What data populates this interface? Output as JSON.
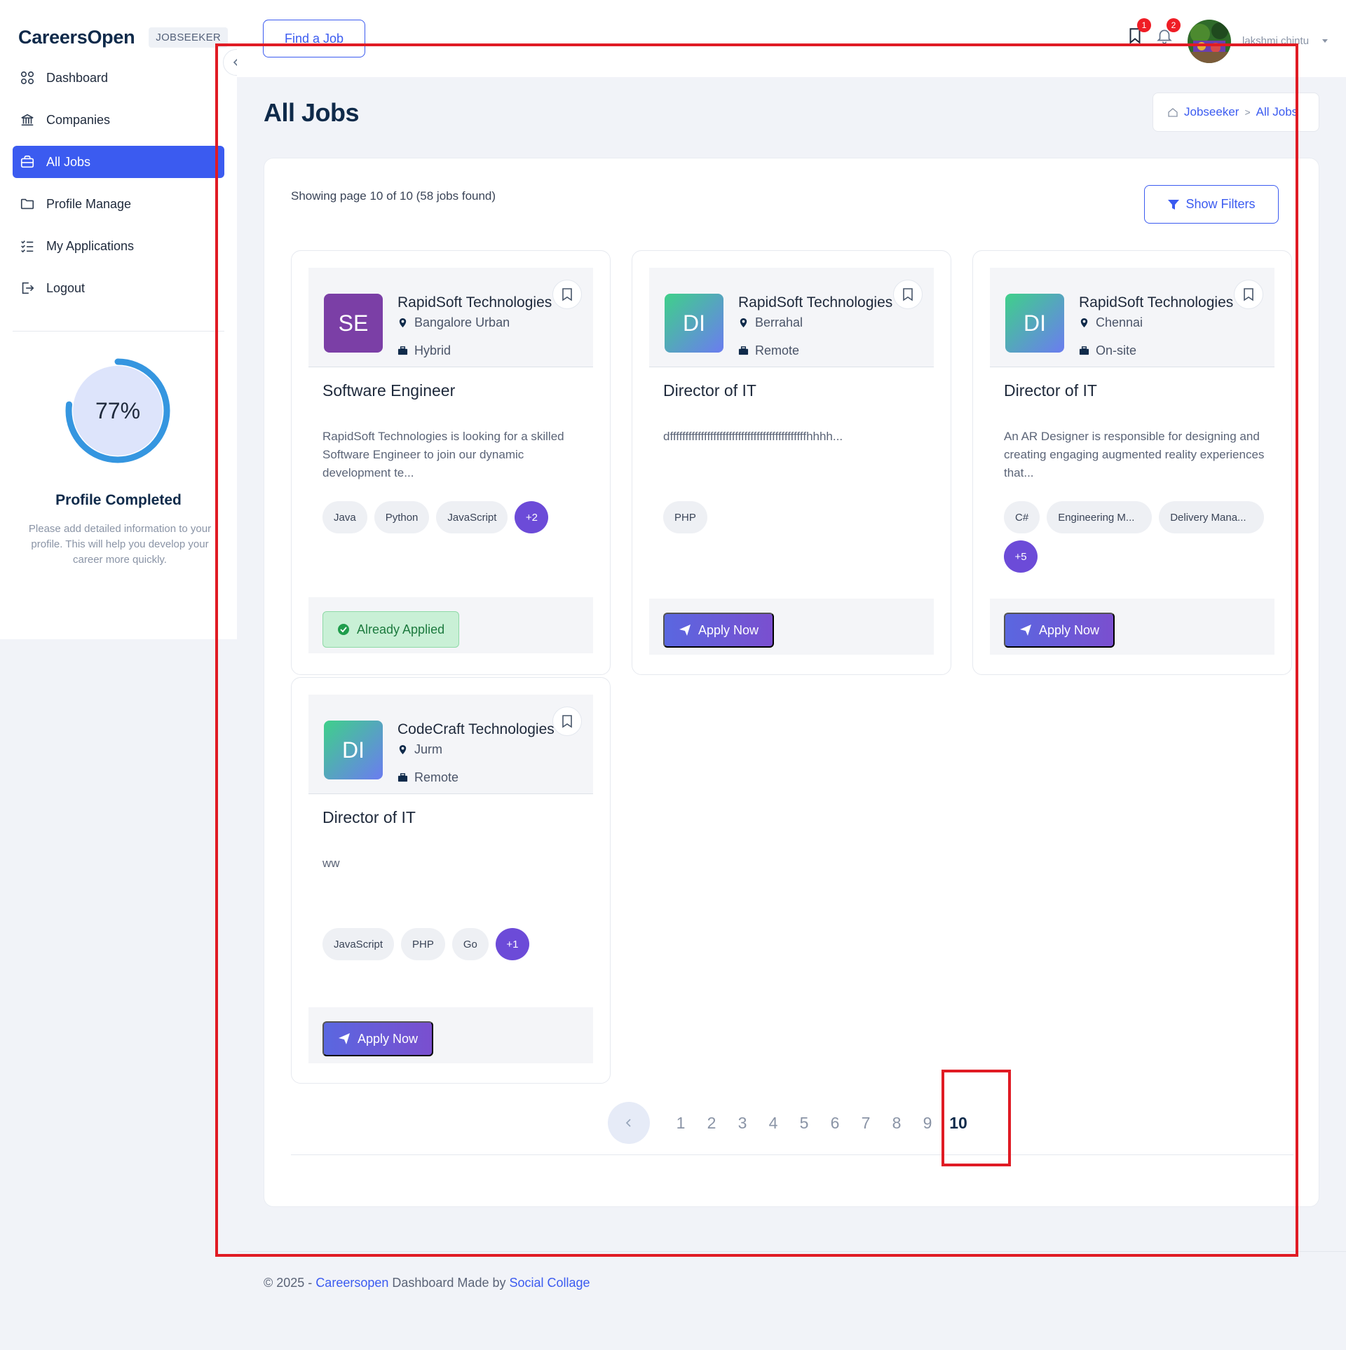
{
  "brand": {
    "name": "CareersOpen",
    "role": "JOBSEEKER"
  },
  "sidebar": {
    "items": [
      {
        "label": "Dashboard",
        "icon": "dashboard-icon",
        "active": false
      },
      {
        "label": "Companies",
        "icon": "building-icon",
        "active": false
      },
      {
        "label": "All Jobs",
        "icon": "briefcase-icon",
        "active": true
      },
      {
        "label": "Profile Manage",
        "icon": "folder-icon",
        "active": false
      },
      {
        "label": "My Applications",
        "icon": "checklist-icon",
        "active": false
      },
      {
        "label": "Logout",
        "icon": "logout-icon",
        "active": false
      }
    ],
    "profile": {
      "percent_label": "77%",
      "percent": 77,
      "title": "Profile Completed",
      "description": "Please add detailed information to your profile. This will help you develop your career more quickly."
    }
  },
  "header": {
    "find_job_label": "Find a Job",
    "saved_badge": "1",
    "notif_badge": "2",
    "user_name": "lakshmi chintu"
  },
  "page": {
    "title": "All Jobs",
    "breadcrumb": {
      "home": "Jobseeker",
      "current": "All Jobs"
    },
    "showing": "Showing page 10 of 10 (58 jobs found)",
    "show_filters_label": "Show Filters"
  },
  "jobs": [
    {
      "initials": "SE",
      "company": "RapidSoft Technologies",
      "location": "Bangalore Urban",
      "work_mode": "Hybrid",
      "title": "Software Engineer",
      "description": "RapidSoft Technologies is looking for a skilled Software Engineer to join our dynamic development te...",
      "tags": [
        "Java",
        "Python",
        "JavaScript"
      ],
      "more": "+2",
      "action": "Already Applied"
    },
    {
      "initials": "DI",
      "company": "RapidSoft Technologies",
      "location": "Berrahal",
      "work_mode": "Remote",
      "title": "Director of IT",
      "description": "dffffffffffffffffffffffffffffffffffffffffffffhhhh...",
      "tags": [
        "PHP"
      ],
      "more": "",
      "action": "Apply Now"
    },
    {
      "initials": "DI",
      "company": "RapidSoft Technologies",
      "location": "Chennai",
      "work_mode": "On-site",
      "title": "Director of IT",
      "description": "An AR Designer is responsible for designing and creating engaging augmented reality experiences that...",
      "tags": [
        "C#",
        "Engineering M...",
        "Delivery Mana..."
      ],
      "more": "+5",
      "action": "Apply Now"
    },
    {
      "initials": "DI",
      "company": "CodeCraft Technologies",
      "location": "Jurm",
      "work_mode": "Remote",
      "title": "Director of IT",
      "description": "ww",
      "tags": [
        "JavaScript",
        "PHP",
        "Go"
      ],
      "more": "+1",
      "action": "Apply Now"
    }
  ],
  "pagination": {
    "pages": [
      "1",
      "2",
      "3",
      "4",
      "5",
      "6",
      "7",
      "8",
      "9",
      "10"
    ],
    "current": "10"
  },
  "footer": {
    "prefix": "© 2025 - ",
    "brand_link": "Careersopen",
    "middle": " Dashboard Made by ",
    "author_link": "Social Collage"
  },
  "colors": {
    "accent": "#3b5bf0",
    "annotation": "#e01b24",
    "applied_bg": "#c9f0d6"
  }
}
